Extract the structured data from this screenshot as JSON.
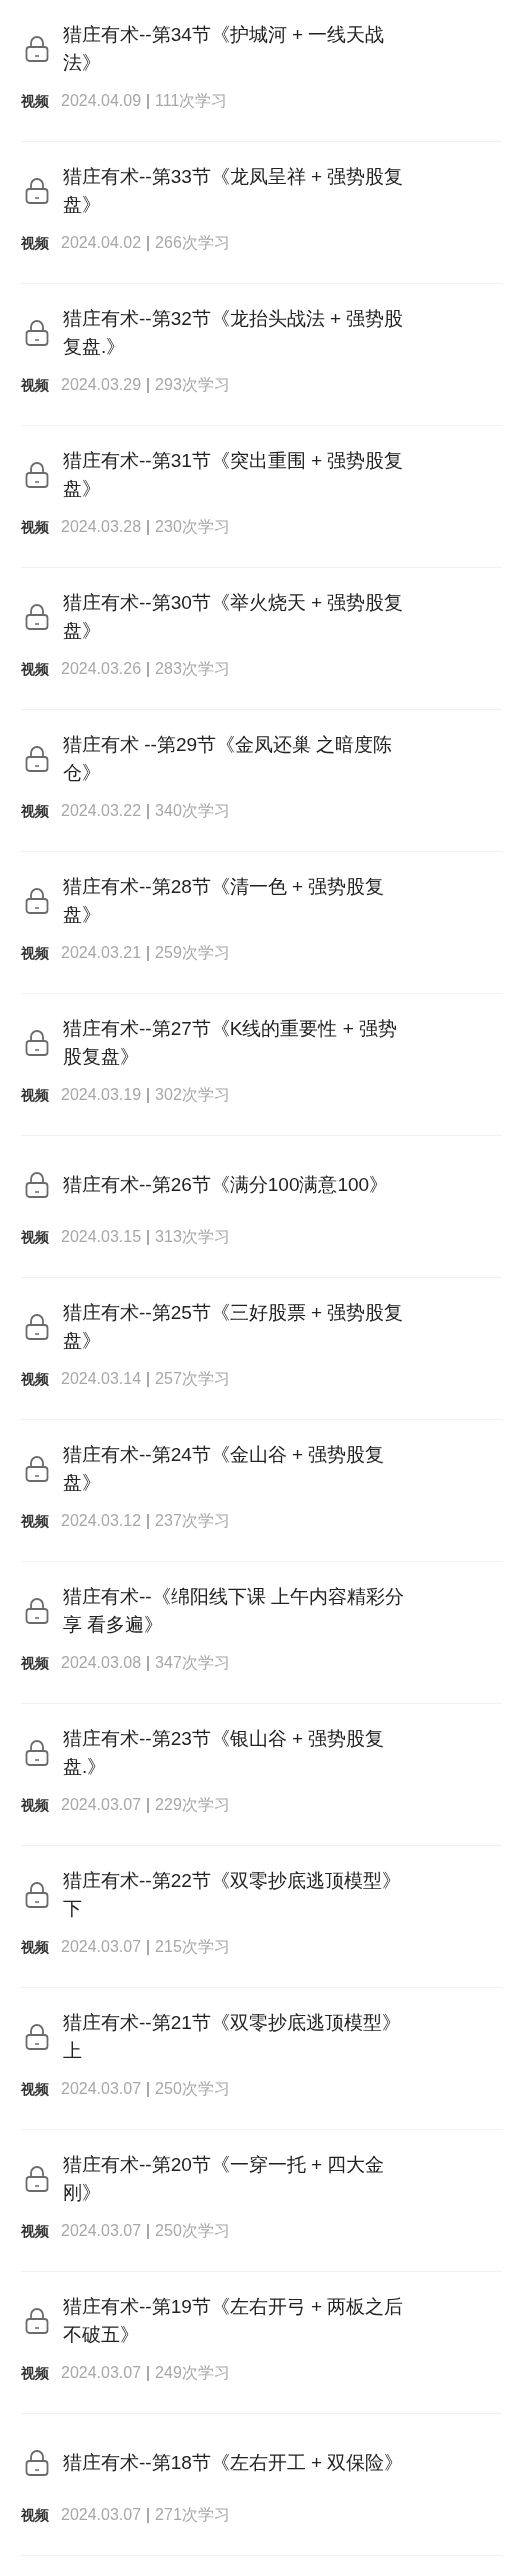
{
  "lessons": [
    {
      "title": "猎庄有术--第34节《护城河 + 一线天战法》",
      "type": "视频",
      "date": "2024.04.09",
      "count": "111次学习",
      "locked": true
    },
    {
      "title": "猎庄有术--第33节《龙凤呈祥 +  强势股复盘》",
      "type": "视频",
      "date": "2024.04.02",
      "count": "266次学习",
      "locked": true
    },
    {
      "title": "猎庄有术--第32节《龙抬头战法 + 强势股复盘.》",
      "type": "视频",
      "date": "2024.03.29",
      "count": "293次学习",
      "locked": true
    },
    {
      "title": "猎庄有术--第31节《突出重围 + 强势股复盘》",
      "type": "视频",
      "date": "2024.03.28",
      "count": "230次学习",
      "locked": true
    },
    {
      "title": "猎庄有术--第30节《举火烧天 + 强势股复盘》",
      "type": "视频",
      "date": "2024.03.26",
      "count": "283次学习",
      "locked": true
    },
    {
      "title": "猎庄有术 --第29节《金凤还巢 之暗度陈仓》",
      "type": "视频",
      "date": "2024.03.22",
      "count": "340次学习",
      "locked": true
    },
    {
      "title": "猎庄有术--第28节《清一色 + 强势股复盘》",
      "type": "视频",
      "date": "2024.03.21",
      "count": "259次学习",
      "locked": true
    },
    {
      "title": "猎庄有术--第27节《K线的重要性 + 强势股复盘》",
      "type": "视频",
      "date": "2024.03.19",
      "count": "302次学习",
      "locked": true
    },
    {
      "title": "猎庄有术--第26节《满分100满意100》",
      "type": "视频",
      "date": "2024.03.15",
      "count": "313次学习",
      "locked": true
    },
    {
      "title": "猎庄有术--第25节《三好股票 + 强势股复盘》",
      "type": "视频",
      "date": "2024.03.14",
      "count": "257次学习",
      "locked": true
    },
    {
      "title": "猎庄有术--第24节《金山谷 + 强势股复盘》",
      "type": "视频",
      "date": "2024.03.12",
      "count": "237次学习",
      "locked": true
    },
    {
      "title": "猎庄有术--《绵阳线下课 上午内容精彩分享 看多遍》",
      "type": "视频",
      "date": "2024.03.08",
      "count": "347次学习",
      "locked": true
    },
    {
      "title": "猎庄有术--第23节《银山谷 + 强势股复盘.》",
      "type": "视频",
      "date": "2024.03.07",
      "count": "229次学习",
      "locked": true
    },
    {
      "title": "猎庄有术--第22节《双零抄底逃顶模型》下",
      "type": "视频",
      "date": "2024.03.07",
      "count": "215次学习",
      "locked": true
    },
    {
      "title": "猎庄有术--第21节《双零抄底逃顶模型》上",
      "type": "视频",
      "date": "2024.03.07",
      "count": "250次学习",
      "locked": true
    },
    {
      "title": "猎庄有术--第20节《一穿一托 + 四大金刚》",
      "type": "视频",
      "date": "2024.03.07",
      "count": "250次学习",
      "locked": true
    },
    {
      "title": "猎庄有术--第19节《左右开弓 + 两板之后不破五》",
      "type": "视频",
      "date": "2024.03.07",
      "count": "249次学习",
      "locked": true
    },
    {
      "title": "猎庄有术--第18节《左右开工 + 双保险》",
      "type": "视频",
      "date": "2024.03.07",
      "count": "271次学习",
      "locked": true
    }
  ]
}
